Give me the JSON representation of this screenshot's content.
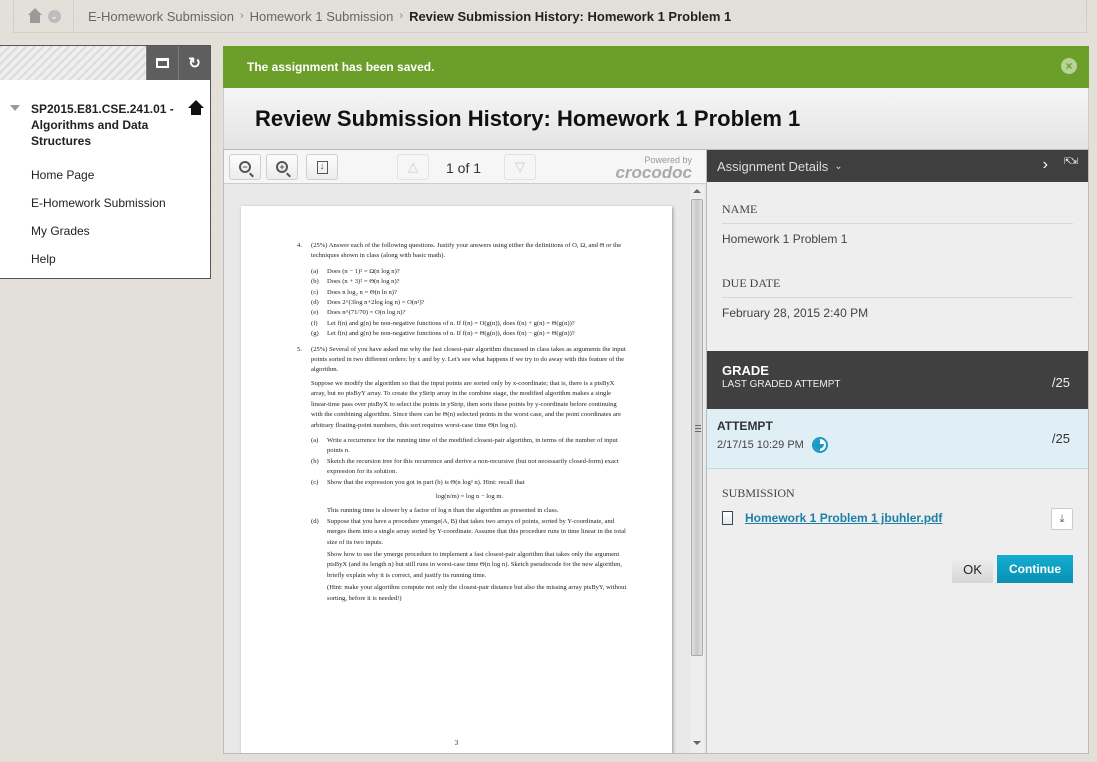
{
  "breadcrumb": {
    "items": [
      "E-Homework Submission",
      "Homework 1 Submission"
    ],
    "current": "Review Submission History: Homework 1 Problem 1",
    "separator": "›"
  },
  "left_nav": {
    "course_title": "SP2015.E81.CSE.241.01 - Algorithms and Data Structures",
    "links": [
      "Home Page",
      "E-Homework Submission",
      "My Grades",
      "Help"
    ]
  },
  "alert": {
    "message": "The assignment has been saved.",
    "close_icon": "×"
  },
  "page_title": "Review Submission History: Homework 1 Problem 1",
  "viewer": {
    "page_indicator": "1 of 1",
    "powered_by": "Powered by",
    "brand": "crocodoc",
    "document": {
      "page_number": "3",
      "q4": {
        "num": "4.",
        "intro": "(25%) Answer each of the following questions. Justify your answers using either the definitions of O, Ω, and Θ or the techniques shown in class (along with basic math).",
        "parts": [
          {
            "label": "(a)",
            "text": "Does (n − 1)² = Ω(n log n)?"
          },
          {
            "label": "(b)",
            "text": "Does (n + 3)² = Θ(n log n)?"
          },
          {
            "label": "(c)",
            "text": "Does n log₂ n = Θ(n ln n)?"
          },
          {
            "label": "(d)",
            "text": "Does 2^(3log n+2log log n) = O(n²)?"
          },
          {
            "label": "(e)",
            "text": "Does n^(71/70) = O(n log n)?"
          },
          {
            "label": "(f)",
            "text": "Let f(n) and g(n) be non-negative functions of n. If f(n) = O(g(n)), does f(n) + g(n) = Θ(g(n))?"
          },
          {
            "label": "(g)",
            "text": "Let f(n) and g(n) be non-negative functions of n. If f(n) = Θ(g(n)), does f(n) − g(n) = Θ(g(n))?"
          }
        ]
      },
      "q5": {
        "num": "5.",
        "intro": "(25%) Several of you have asked me why the fast closest-pair algorithm discussed in class takes as arguments the input points sorted in two different orders: by x and by y. Let's see what happens if we try to do away with this feature of the algorithm.",
        "para": "Suppose we modify the algorithm so that the input points are sorted only by x-coordinate; that is, there is a ptsByX array, but no ptsByY array. To create the yStrip array in the combine stage, the modified algorithm makes a single linear-time pass over ptsByX to select the points in yStrip, then sorts these points by y-coordinate before continuing with the combining algorithm. Since there can be Θ(n) selected points in the worst case, and the point coordinates are arbitrary floating-point numbers, this sort requires worst-case time Θ(n log n).",
        "parts": [
          {
            "label": "(a)",
            "text": "Write a recurrence for the running time of the modified closest-pair algorithm, in terms of the number of input points n."
          },
          {
            "label": "(b)",
            "text": "Sketch the recursion tree for this recurrence and derive a non-recursive (but not necessarily closed-form) exact expression for its solution."
          },
          {
            "label": "(c)",
            "text": "Show that the expression you got in part (b) is Θ(n log² n). Hint: recall that"
          }
        ],
        "formula": "log(n/m) = log n − log m.",
        "after_c": "This running time is slower by a factor of log n than the algorithm as presented in class.",
        "part_d": {
          "label": "(d)",
          "text": "Suppose that you have a procedure ymerge(A, B) that takes two arrays of points, sorted by Y-coordinate, and merges them into a single array sorted by Y-coordinate. Assume that this procedure runs in time linear in the total size of its two inputs.",
          "text2": "Show how to use the ymerge procedure to implement a fast closest-pair algorithm that takes only the argument ptsByX (and its length n) but still runs in worst-case time Θ(n log n). Sketch pseudocode for the new algorithm, briefly explain why it is correct, and justify its running time.",
          "hint": "(Hint: make your algorithm compute not only the closest-pair distance but also the missing array ptsByY, without sorting, before it is needed!)"
        }
      }
    }
  },
  "details": {
    "header": "Assignment Details",
    "name_label": "NAME",
    "name_value": "Homework 1 Problem 1",
    "due_label": "DUE DATE",
    "due_value": "February 28, 2015 2:40 PM",
    "grade": {
      "title": "GRADE",
      "subtitle": "LAST GRADED ATTEMPT",
      "score": "/25"
    },
    "attempt": {
      "title": "ATTEMPT",
      "date": "2/17/15 10:29 PM",
      "score": "/25"
    },
    "submission_label": "SUBMISSION",
    "file_name": "Homework 1 Problem 1 jbuhler.pdf",
    "ok_label": "OK",
    "continue_label": "Continue"
  },
  "colors": {
    "alert_green": "#6b9f29",
    "accent_blue": "#0b8fb3",
    "dark_header": "#404040",
    "attempt_bg": "#dfeff5"
  }
}
